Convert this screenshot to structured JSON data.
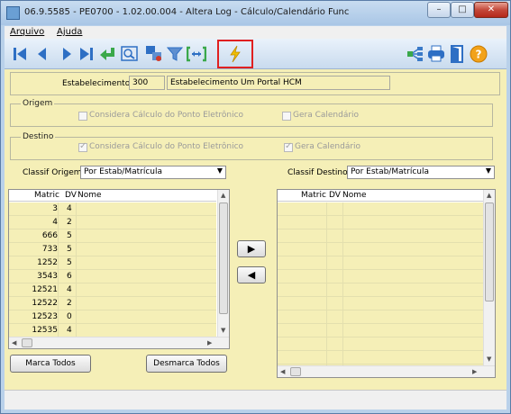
{
  "window": {
    "title": "06.9.5585 - PE0700 - 1.02.00.004 - Altera Log - Cálculo/Calendário Func",
    "minimize": "–",
    "maximize": "□",
    "close": "✕"
  },
  "menu": {
    "items": [
      "Arquivo",
      "Ajuda"
    ]
  },
  "toolbar": {
    "left_icons": [
      "first-record-icon",
      "previous-record-icon",
      "next-record-icon",
      "last-record-icon",
      "go-to-icon",
      "search-icon",
      "zoom-icon",
      "filter-icon",
      "range-icon",
      "execute-lightning-icon"
    ],
    "right_icons": [
      "hierarchy-icon",
      "print-icon",
      "exit-icon",
      "help-icon"
    ],
    "highlight_color": "#e02020"
  },
  "estabelecimento": {
    "label": "Estabelecimento:",
    "code": "300",
    "name": "Estabelecimento Um Portal HCM"
  },
  "origem": {
    "title": "Origem",
    "considera_calculo": "Considera Cálculo do Ponto Eletrônico",
    "gera_calendario": "Gera Calendário",
    "considera_checked": false,
    "gera_checked": false
  },
  "destino": {
    "title": "Destino",
    "considera_calculo": "Considera Cálculo do Ponto Eletrônico",
    "gera_calendario": "Gera Calendário",
    "considera_checked": true,
    "gera_checked": true
  },
  "classif_origem": {
    "label": "Classif Origem:",
    "value": "Por Estab/Matrícula"
  },
  "classif_destino": {
    "label": "Classif Destino:",
    "value": "Por Estab/Matrícula"
  },
  "left_grid": {
    "columns": [
      "Matric",
      "DV",
      "Nome"
    ],
    "rows": [
      {
        "matric": "3",
        "dv": "4",
        "nome": ""
      },
      {
        "matric": "4",
        "dv": "2",
        "nome": ""
      },
      {
        "matric": "666",
        "dv": "5",
        "nome": ""
      },
      {
        "matric": "733",
        "dv": "5",
        "nome": ""
      },
      {
        "matric": "1252",
        "dv": "5",
        "nome": ""
      },
      {
        "matric": "3543",
        "dv": "6",
        "nome": ""
      },
      {
        "matric": "12521",
        "dv": "4",
        "nome": ""
      },
      {
        "matric": "12522",
        "dv": "2",
        "nome": ""
      },
      {
        "matric": "12523",
        "dv": "0",
        "nome": ""
      },
      {
        "matric": "12535",
        "dv": "4",
        "nome": ""
      }
    ]
  },
  "right_grid": {
    "columns": [
      "Matric",
      "DV",
      "Nome"
    ],
    "rows": []
  },
  "transfer": {
    "right_arrow": "▶",
    "left_arrow": "◀"
  },
  "buttons": {
    "marca_todos": "Marca Todos",
    "desmarca_todos": "Desmarca Todos"
  },
  "colors": {
    "form_background": "#f5efb7",
    "window_frame": "#b9d1ea",
    "toolbar_blue": "#2e6fc4",
    "accent_green": "#3aa84a",
    "lightning": "#f0c000"
  }
}
